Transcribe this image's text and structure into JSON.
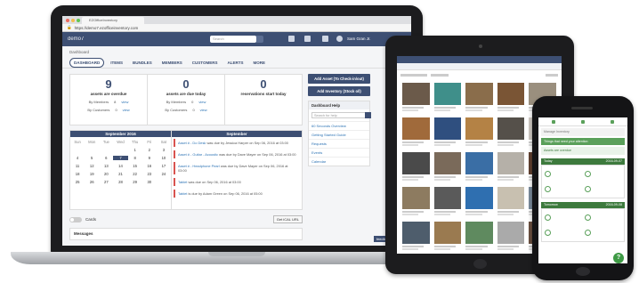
{
  "laptop": {
    "browser_tab": "EZOfficeInventory",
    "url": "https://demo7.ezofficeinventory.com",
    "app_name": "demo7",
    "search_placeholder": "Search",
    "user_name": "Sam Gran Jr.",
    "breadcrumb": "Dashboard",
    "nav_tabs": [
      "DASHBOARD",
      "ITEMS",
      "BUNDLES",
      "MEMBERS",
      "CUSTOMERS",
      "ALERTS",
      "MORE"
    ],
    "stats": [
      {
        "number": "9",
        "label": "assets are overdue",
        "rows": [
          {
            "name": "By Members",
            "count": "8",
            "link": "view"
          },
          {
            "name": "By Customers",
            "count": "0",
            "link": "view"
          }
        ]
      },
      {
        "number": "0",
        "label": "assets are due today",
        "rows": [
          {
            "name": "By Members",
            "count": "0",
            "link": "view"
          },
          {
            "name": "By Customers",
            "count": "0",
            "link": "view"
          }
        ]
      },
      {
        "number": "0",
        "label": "reservations start today",
        "rows": []
      }
    ],
    "calendar": {
      "month": "September 2016",
      "day_names": [
        "Sun",
        "Mon",
        "Tue",
        "Wed",
        "Thu",
        "Fri",
        "Sat"
      ],
      "rows": [
        [
          "",
          "",
          "",
          "",
          "1",
          "2",
          "3"
        ],
        [
          "4",
          "5",
          "6",
          "7",
          "8",
          "9",
          "10"
        ],
        [
          "11",
          "12",
          "13",
          "14",
          "15",
          "16",
          "17"
        ],
        [
          "18",
          "19",
          "20",
          "21",
          "22",
          "23",
          "24"
        ],
        [
          "25",
          "26",
          "27",
          "28",
          "29",
          "30",
          ""
        ]
      ],
      "selected_day": "7"
    },
    "events_header": "September",
    "events": [
      {
        "link": "Asset # - Do Desk",
        "text": "was due by Jessica Harper on Sep 06, 2016 at 03:00"
      },
      {
        "link": "Asset # - Guitar - Acoustic",
        "text": "was due by Dave Mayer on Sep 06, 2016 at 03:00"
      },
      {
        "link": "Asset # - Headphone Pearl",
        "text": "was due by Dave Mayer on Sep 06, 2016 at 03:00"
      },
      {
        "link": "Tablet",
        "text": "was due on Sep 06, 2016 at 03:00"
      },
      {
        "link": "Tablet",
        "text": "is due by Adam Green on Sep 06, 2016 at 05:00"
      }
    ],
    "side_buttons": [
      "Add Asset (To Check-in/out)",
      "Add Inventory (Stock o/l)"
    ],
    "help": {
      "title": "Dashboard Help",
      "search_placeholder": "Search for help",
      "links": [
        "60 Seconds Overview",
        "Getting Started Guide",
        "Requests",
        "Events",
        "Calendar"
      ]
    },
    "toggle_label": "Cards",
    "ical_button": "Get iCAL URL",
    "messages_label": "Messages",
    "feedback_label": "feedback & suppo"
  },
  "tablet": {
    "image_colors": [
      "#6b5a4a",
      "#3f8f8a",
      "#8a6d4b",
      "#7a5535",
      "#9a8f7e",
      "#a06a3b",
      "#2f4f7f",
      "#b48245",
      "#55504a",
      "#cfcac3",
      "#4a4a4a",
      "#7a6a5a",
      "#3a6ea5",
      "#b5b0a8",
      "#604030",
      "#8d7b60",
      "#5a5a5a",
      "#2f6fb0",
      "#c8c0b0",
      "#7a8a9a",
      "#4e5d6c",
      "#9a7a50",
      "#5f8a5f",
      "#aaaaaa",
      "#6a5040"
    ]
  },
  "phone": {
    "header": "Manage Inventory",
    "alert": "Things that need your attention",
    "status": "Assets are overdue",
    "section1_title": "Today",
    "section1_date": "2016-09-07",
    "section2_title": "Tomorrow",
    "section2_date": "2016-09-08",
    "fab_icon": "?"
  },
  "colors": {
    "brand": "#3d4f73",
    "link": "#2e74b5",
    "green": "#5aa05a"
  }
}
